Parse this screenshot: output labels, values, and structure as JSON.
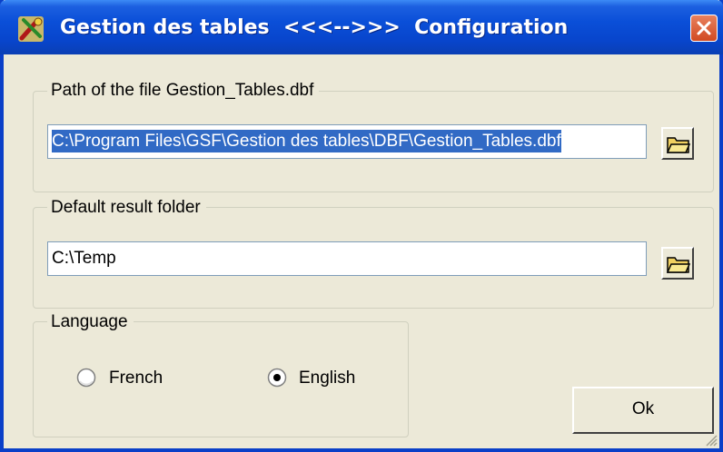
{
  "window": {
    "title": "Gestion des tables  <<<-->>>  Configuration",
    "colors": {
      "titlebar": "#0a4fd8",
      "face": "#ece9d8",
      "selection": "#316ac5"
    }
  },
  "dbf_path_group": {
    "label": "Path of the file Gestion_Tables.dbf",
    "value": "C:\\Program Files\\GSF\\Gestion des tables\\DBF\\Gestion_Tables.dbf",
    "browse_icon": "folder-icon"
  },
  "result_folder_group": {
    "label": "Default result folder",
    "value": "C:\\Temp",
    "browse_icon": "folder-icon"
  },
  "language_group": {
    "label": "Language",
    "options": [
      {
        "label": "French",
        "selected": false
      },
      {
        "label": "English",
        "selected": true
      }
    ]
  },
  "ok_button": {
    "label": "Ok"
  }
}
